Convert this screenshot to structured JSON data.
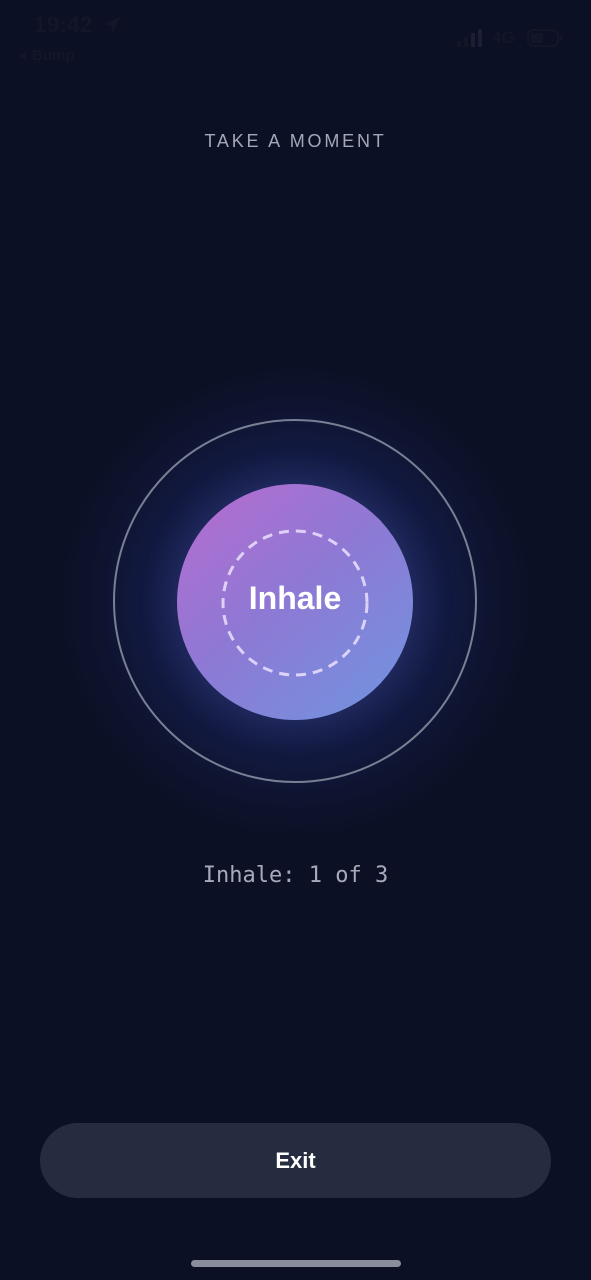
{
  "status_bar": {
    "time": "19:42",
    "back_app": "Bump",
    "network": "4G",
    "icons": [
      "location-arrow-icon",
      "signal-bars-icon",
      "battery-icon"
    ]
  },
  "screen": {
    "heading": "TAKE A MOMENT",
    "phase": "Inhale",
    "counter": "Inhale: 1 of 3"
  },
  "actions": {
    "exit_label": "Exit"
  },
  "colors": {
    "background": "#0c1025",
    "orb_start": "#b96ccf",
    "orb_end": "#6f95e0",
    "button": "#262c40",
    "muted_text": "#a3a8b8"
  }
}
